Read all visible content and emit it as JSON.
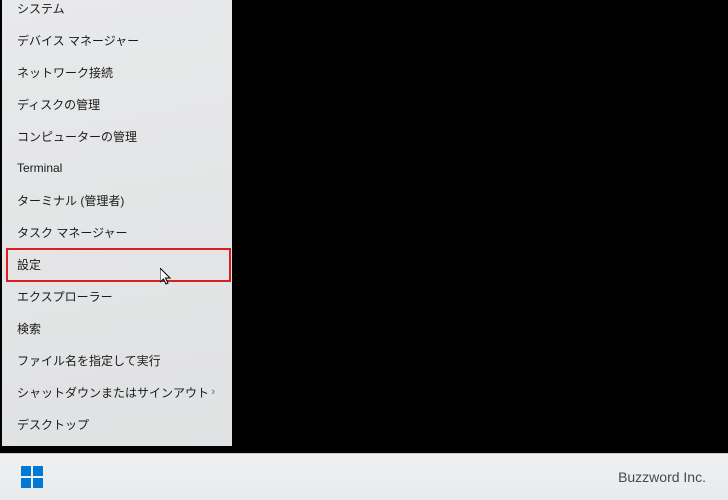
{
  "context_menu": {
    "items": [
      {
        "label": "システム",
        "has_submenu": false
      },
      {
        "label": "デバイス マネージャー",
        "has_submenu": false
      },
      {
        "label": "ネットワーク接続",
        "has_submenu": false
      },
      {
        "label": "ディスクの管理",
        "has_submenu": false
      },
      {
        "label": "コンピューターの管理",
        "has_submenu": false
      },
      {
        "label": "Terminal",
        "has_submenu": false
      },
      {
        "label": "ターミナル (管理者)",
        "has_submenu": false
      },
      {
        "label": "タスク マネージャー",
        "has_submenu": false
      },
      {
        "label": "設定",
        "has_submenu": false,
        "highlighted": true
      },
      {
        "label": "エクスプローラー",
        "has_submenu": false
      },
      {
        "label": "検索",
        "has_submenu": false
      },
      {
        "label": "ファイル名を指定して実行",
        "has_submenu": false
      },
      {
        "label": "シャットダウンまたはサインアウト",
        "has_submenu": true
      },
      {
        "label": "デスクトップ",
        "has_submenu": false
      }
    ]
  },
  "taskbar": {
    "attribution": "Buzzword Inc."
  },
  "colors": {
    "highlight_border": "#d92020",
    "start_blue": "#0078d4"
  }
}
